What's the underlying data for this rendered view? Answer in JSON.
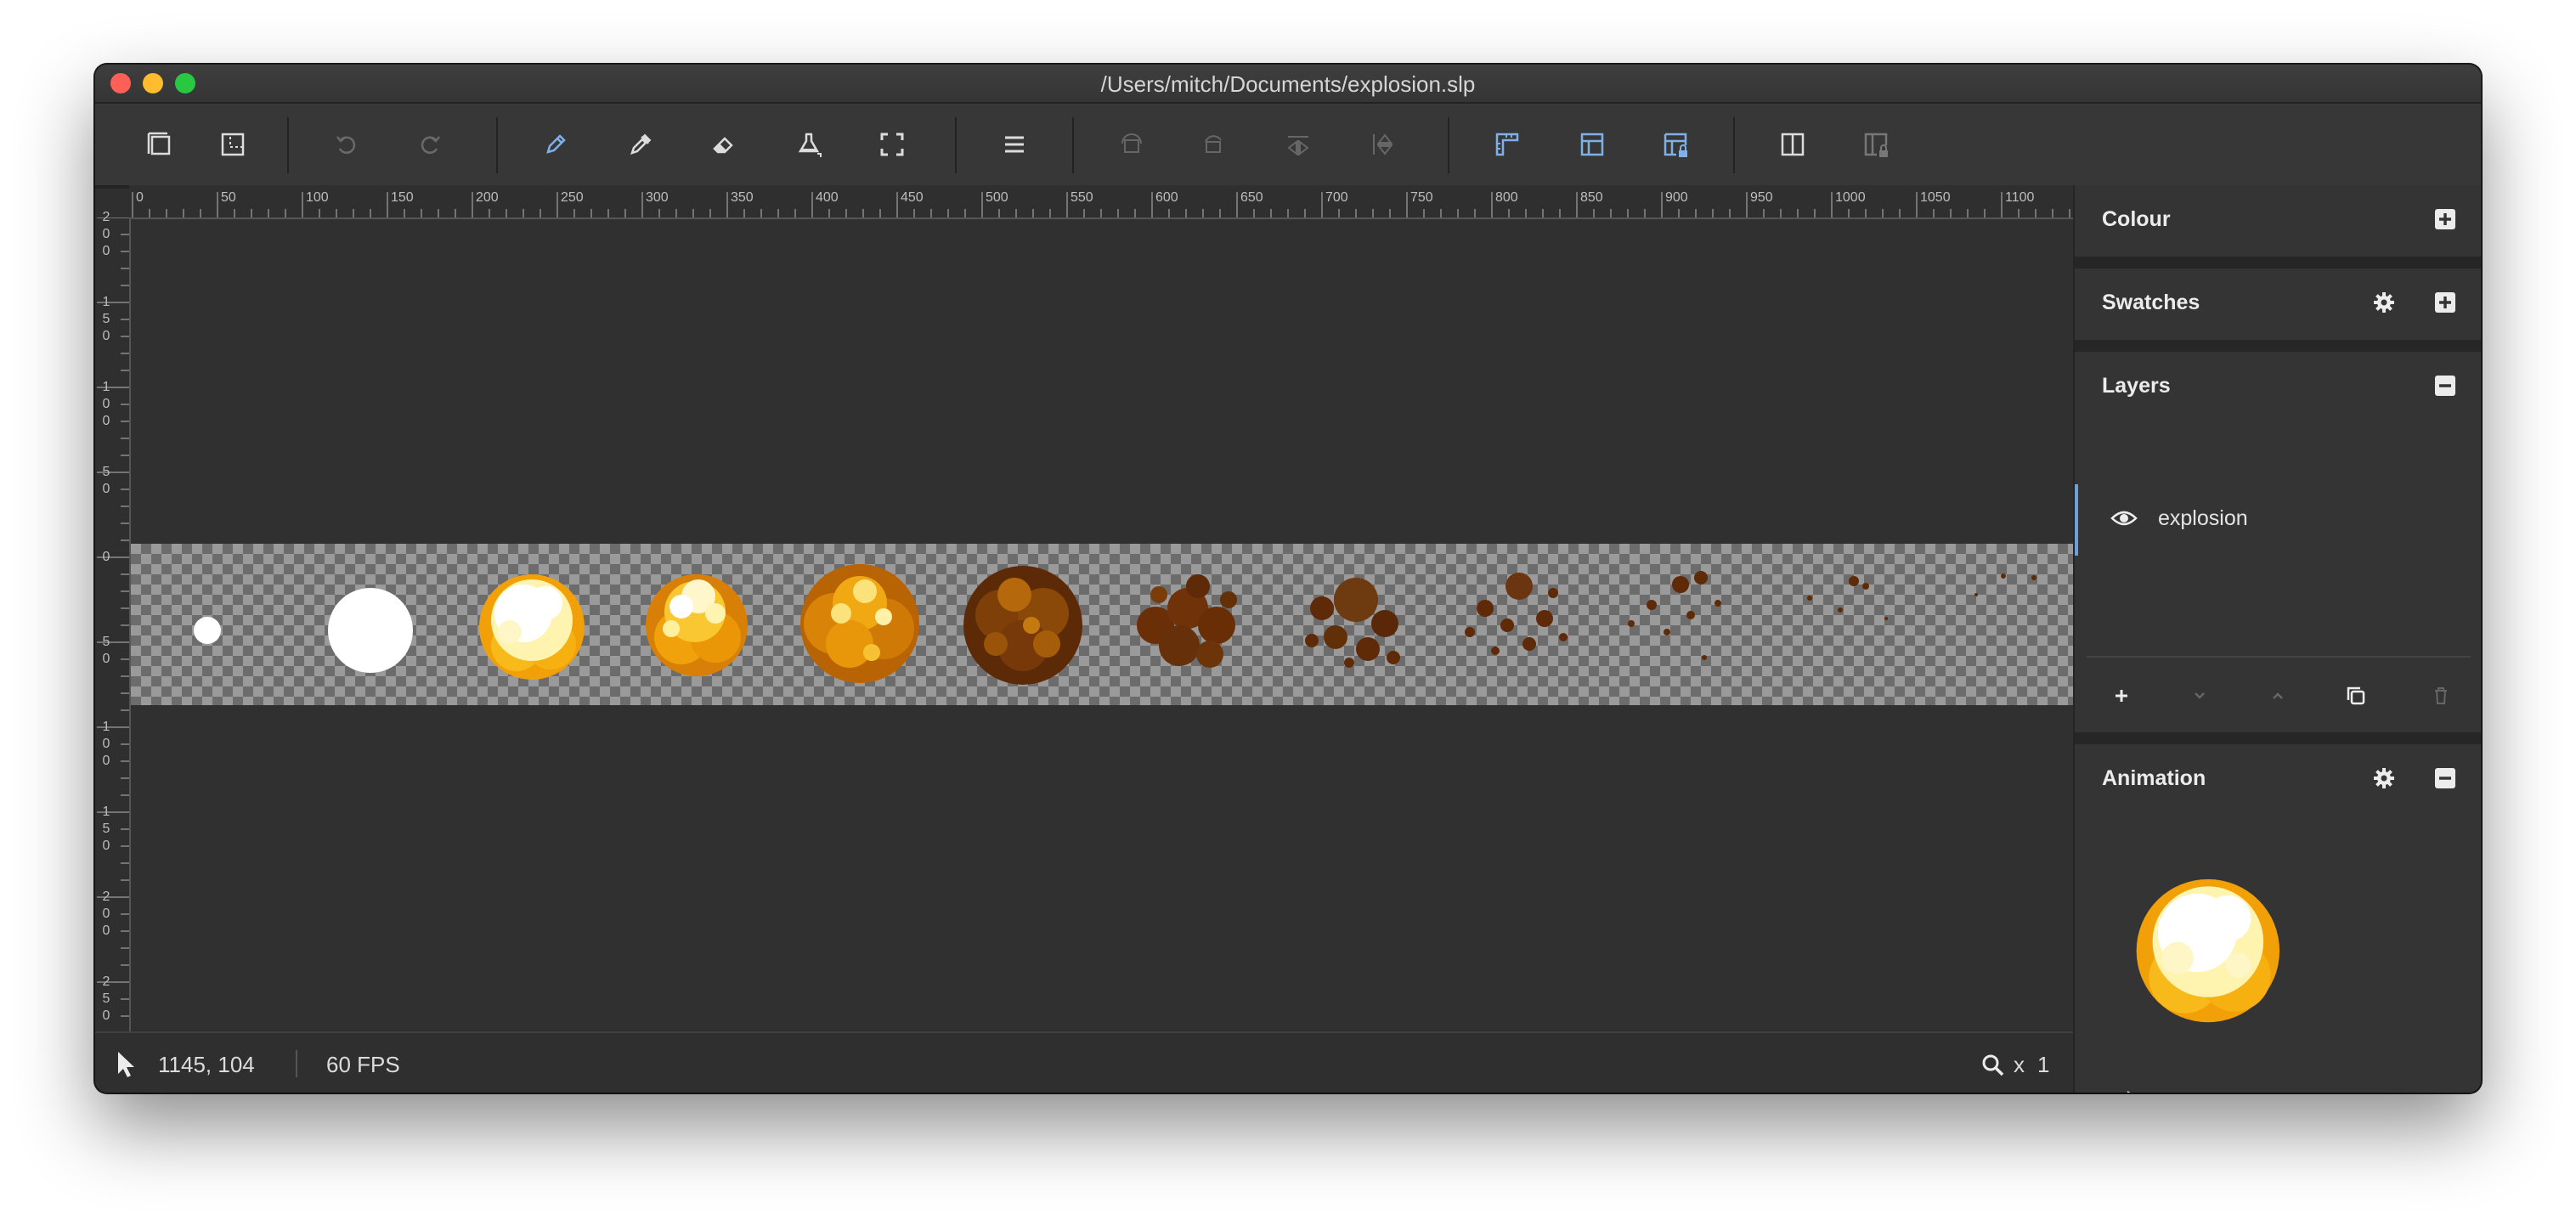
{
  "window": {
    "title": "/Users/mitch/Documents/explosion.slp"
  },
  "toolbar": {
    "tools": [
      "canvas-size-icon",
      "image-size-icon",
      "undo-icon",
      "redo-icon",
      "pencil-icon",
      "eyedropper-icon",
      "eraser-icon",
      "fill-icon",
      "selection-icon",
      "menu-icon",
      "flip-horizontal-icon",
      "rotate-icon",
      "flip-icon-1",
      "flip-icon-2",
      "ruler-guides-icon",
      "grid-icon",
      "lock-guides-icon",
      "split-view-icon",
      "lock-split-view-icon"
    ]
  },
  "ruler": {
    "top_labels": [
      "0",
      "50",
      "100",
      "150",
      "200",
      "250",
      "300",
      "350",
      "400",
      "450",
      "500",
      "550",
      "600",
      "650",
      "700",
      "750",
      "800",
      "850",
      "900",
      "950",
      "1000",
      "1050",
      "1100"
    ],
    "left_labels": [
      "200",
      "150",
      "100",
      "50",
      "0",
      "50",
      "100",
      "150",
      "200",
      "250"
    ]
  },
  "status": {
    "cursor_position": "1145, 104",
    "fps": "60 FPS",
    "zoom_prefix": "x",
    "zoom_value": "1"
  },
  "panels": {
    "colour": {
      "title": "Colour"
    },
    "swatches": {
      "title": "Swatches"
    },
    "layers": {
      "title": "Layers",
      "items": [
        {
          "name": "explosion",
          "visible": true
        }
      ]
    },
    "animation": {
      "title": "Animation",
      "progress": 0.18
    }
  },
  "colors": {
    "accent": "#7fb0e8",
    "window_bg": "#2f2f2f",
    "checker_light": "#9a9a9a",
    "checker_dark": "#6c6c6c"
  }
}
